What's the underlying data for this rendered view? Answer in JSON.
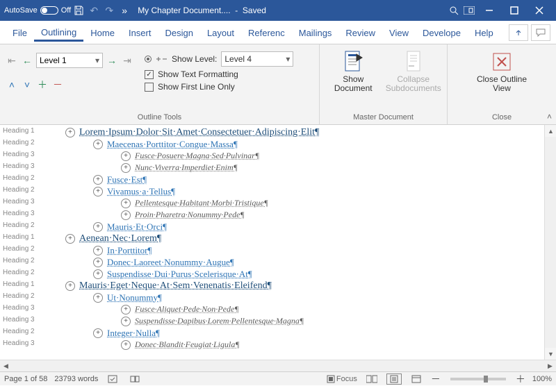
{
  "title": {
    "autosave_label": "AutoSave",
    "autosave_state": "Off",
    "doc": "My Chapter Document....",
    "status": "Saved"
  },
  "tabs": {
    "file": "File",
    "outlining": "Outlining",
    "home": "Home",
    "insert": "Insert",
    "design": "Design",
    "layout": "Layout",
    "references": "Referenc",
    "mailings": "Mailings",
    "review": "Review",
    "view": "View",
    "developer": "Develope",
    "help": "Help"
  },
  "ribbon": {
    "outline_tools_label": "Outline Tools",
    "level_value": "Level 1",
    "show_level_label": "Show Level:",
    "show_level_value": "Level 4",
    "show_text_formatting": "Show Text Formatting",
    "show_first_line": "Show First Line Only",
    "master_doc_label": "Master Document",
    "show_doc_label": "Show Document",
    "collapse_sub_label": "Collapse Subdocuments",
    "close_group_label": "Close",
    "close_btn_label": "Close Outline View"
  },
  "headings": [
    "Heading 1",
    "Heading 2",
    "Heading 3",
    "Heading 3",
    "Heading 2",
    "Heading 2",
    "Heading 3",
    "Heading 3",
    "Heading 2",
    "Heading 1",
    "Heading 2",
    "Heading 2",
    "Heading 2",
    "Heading 1",
    "Heading 2",
    "Heading 3",
    "Heading 3",
    "Heading 2",
    "Heading 3"
  ],
  "outline": [
    {
      "l": 1,
      "k": "h1",
      "t": "Lorem·Ipsum·Dolor·Sit·Amet·Consectetuer·Adipiscing·Elit¶"
    },
    {
      "l": 2,
      "k": "h2",
      "t": "Maecenas·Porttitor·Congue·Massa¶"
    },
    {
      "l": 3,
      "k": "h3",
      "t": "Fusce·Posuere·Magna·Sed·Pulvinar¶"
    },
    {
      "l": 3,
      "k": "h3",
      "t": "Nunc·Viverra·Imperdiet·Enim¶"
    },
    {
      "l": 2,
      "k": "h2",
      "t": "Fusce·Est¶"
    },
    {
      "l": 2,
      "k": "h2",
      "t": "Vivamus·a·Tellus¶"
    },
    {
      "l": 3,
      "k": "h3",
      "t": "Pellentesque·Habitant·Morbi·Tristique¶"
    },
    {
      "l": 3,
      "k": "h3",
      "t": "Proin·Pharetra·Nonummy·Pede¶"
    },
    {
      "l": 2,
      "k": "h2",
      "t": "Mauris·Et·Orci¶"
    },
    {
      "l": 1,
      "k": "h1",
      "t": "Aenean·Nec·Lorem¶"
    },
    {
      "l": 2,
      "k": "h2",
      "t": "In·Porttitor¶"
    },
    {
      "l": 2,
      "k": "h2",
      "t": "Donec·Laoreet·Nonummy·Augue¶"
    },
    {
      "l": 2,
      "k": "h2",
      "t": "Suspendisse·Dui·Purus·Scelerisque·At¶"
    },
    {
      "l": 1,
      "k": "h1",
      "t": "Mauris·Eget·Neque·At·Sem·Venenatis·Eleifend¶"
    },
    {
      "l": 2,
      "k": "h2",
      "t": "Ut·Nonummy¶"
    },
    {
      "l": 3,
      "k": "h3",
      "t": "Fusce·Aliquet·Pede·Non·Pede¶"
    },
    {
      "l": 3,
      "k": "h3",
      "t": "Suspendisse·Dapibus·Lorem·Pellentesque·Magna¶"
    },
    {
      "l": 2,
      "k": "h2",
      "t": "Integer·Nulla¶"
    },
    {
      "l": 3,
      "k": "h3",
      "t": "Donec·Blandit·Feugiat·Ligula¶"
    }
  ],
  "status": {
    "page": "Page 1 of 58",
    "words": "23793 words",
    "focus": "Focus",
    "zoom": "100%"
  }
}
